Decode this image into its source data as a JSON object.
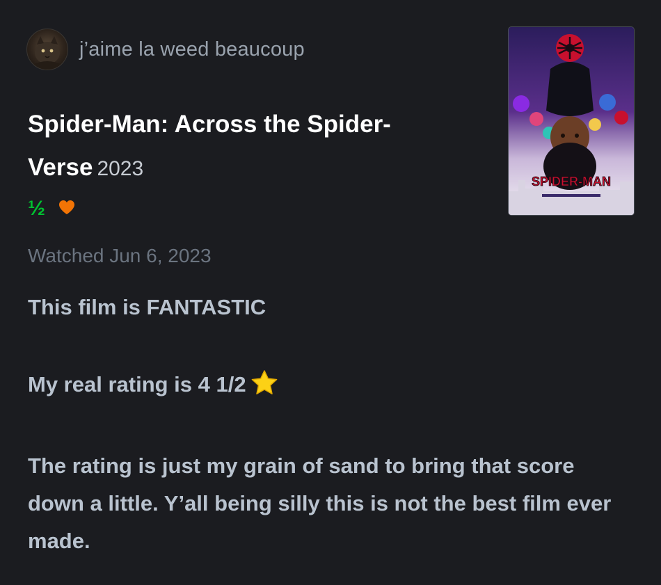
{
  "review": {
    "author": {
      "username": "j’aime la weed beaucoup"
    },
    "film": {
      "title": "Spider-Man: Across the Spider-Verse",
      "year": "2023"
    },
    "rating": {
      "display": "½",
      "stars_value": 0.5,
      "liked": true
    },
    "poster": {
      "wordmark": "SPIDER-MAN"
    },
    "watched_label": "Watched Jun 6, 2023",
    "body": {
      "paragraph_1": "This film is FANTASTIC",
      "paragraph_2": "My real rating is 4 1/2",
      "paragraph_2_emoji": "star-icon",
      "paragraph_3": "The rating is just my grain of sand to bring that score down a little. Y’all being silly this is not the best film ever made."
    }
  },
  "colors": {
    "background": "#1b1c20",
    "rating_green": "#00c030",
    "like_orange": "#f27405",
    "username": "#9aa3ae",
    "body_text": "#b9c3cf",
    "muted": "#6b7480"
  }
}
